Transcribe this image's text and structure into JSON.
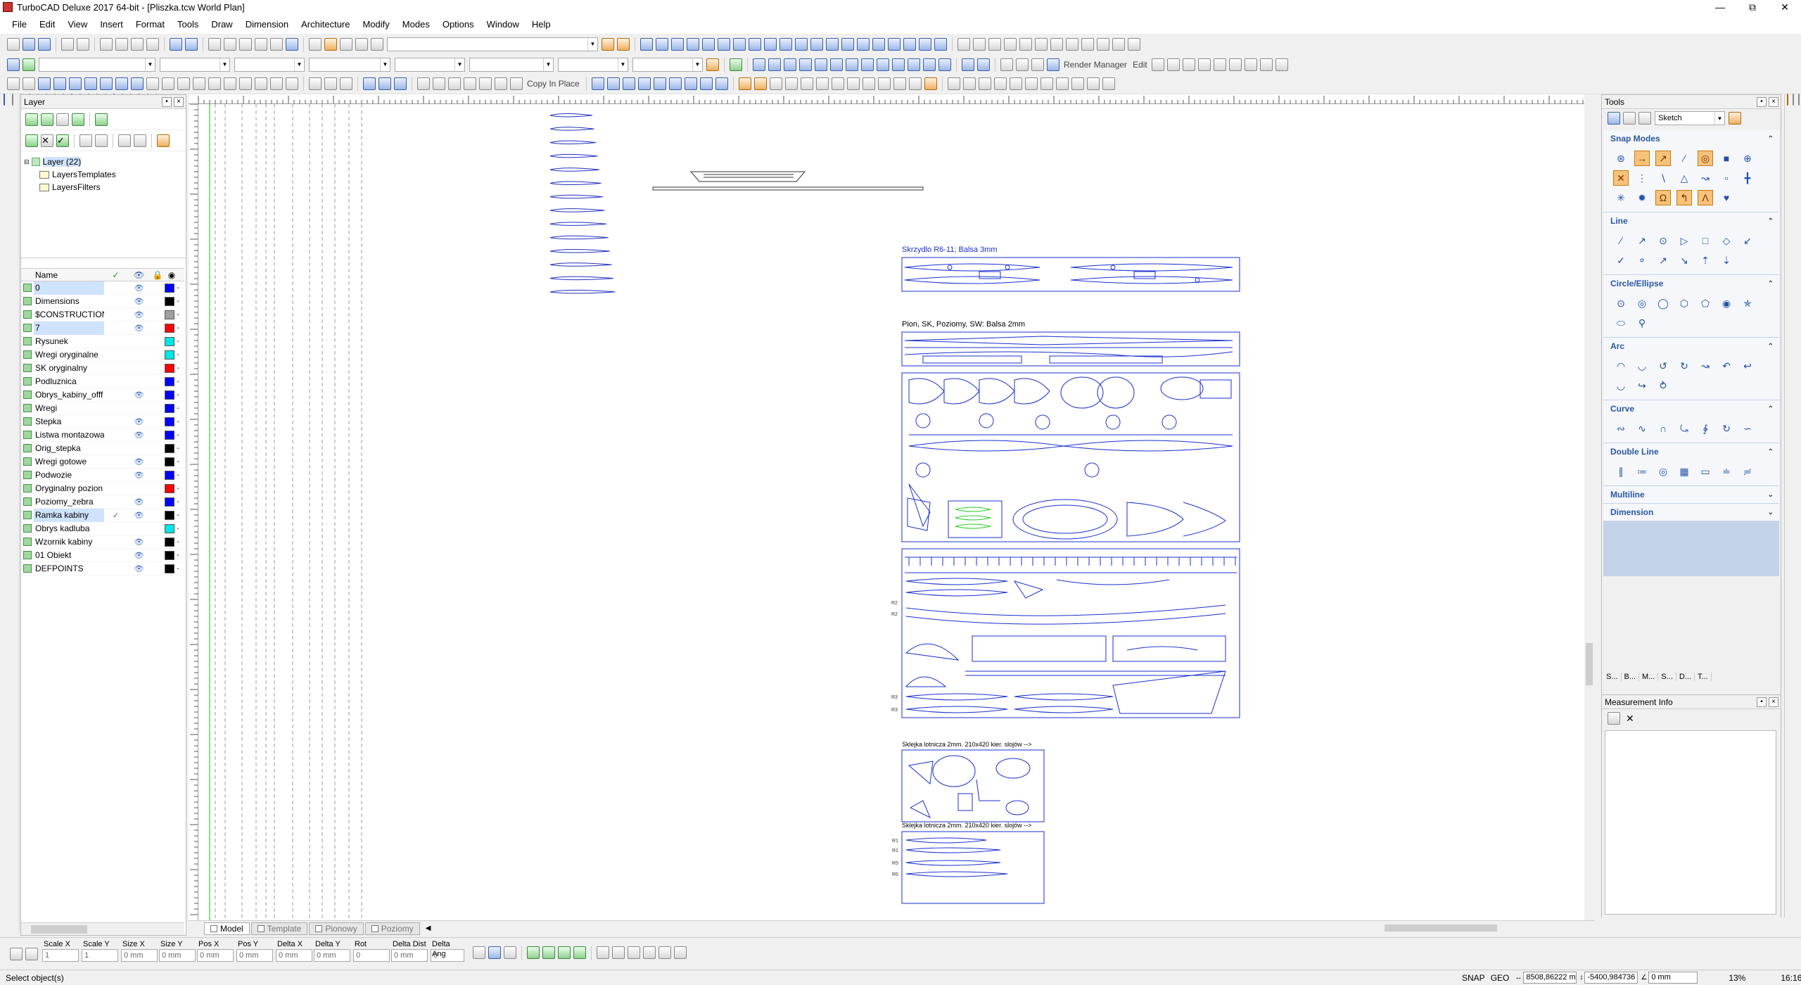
{
  "window": {
    "title": "TurboCAD Deluxe 2017 64-bit - [Pliszka.tcw World Plan]"
  },
  "menu": [
    "File",
    "Edit",
    "View",
    "Insert",
    "Format",
    "Tools",
    "Draw",
    "Dimension",
    "Architecture",
    "Modify",
    "Modes",
    "Options",
    "Window",
    "Help"
  ],
  "toolbar2": {
    "render_manager": "Render Manager",
    "edit": "Edit"
  },
  "toolbar3": {
    "copy_in_place": "Copy In Place"
  },
  "layer_panel": {
    "title": "Layer",
    "tree": [
      {
        "label": "Layer (22)"
      },
      {
        "label": "LayersTemplates"
      },
      {
        "label": "LayersFilters"
      }
    ],
    "columns": {
      "name": "Name"
    },
    "rows": [
      {
        "name": "0",
        "visible": true,
        "active": false,
        "color": "#0000ff",
        "selected": true
      },
      {
        "name": "Dimensions",
        "visible": true,
        "active": false,
        "color": "#000000",
        "selected": false
      },
      {
        "name": "$CONSTRUCTION",
        "visible": true,
        "active": false,
        "color": "#a0a0a0",
        "selected": false
      },
      {
        "name": "7",
        "visible": true,
        "active": false,
        "color": "#ff0000",
        "selected": true
      },
      {
        "name": "Rysunek",
        "visible": false,
        "active": false,
        "color": "#00e5e5",
        "selected": false
      },
      {
        "name": "Wregi oryginalne",
        "visible": false,
        "active": false,
        "color": "#00e5e5",
        "selected": false
      },
      {
        "name": "SK oryginalny",
        "visible": false,
        "active": false,
        "color": "#ff0000",
        "selected": false
      },
      {
        "name": "Podluznica",
        "visible": false,
        "active": false,
        "color": "#0000ff",
        "selected": false
      },
      {
        "name": "Obrys_kabiny_offf",
        "visible": true,
        "active": false,
        "color": "#0000ff",
        "selected": false
      },
      {
        "name": "Wregi",
        "visible": false,
        "active": false,
        "color": "#0000ff",
        "selected": false
      },
      {
        "name": "Stepka",
        "visible": true,
        "active": false,
        "color": "#0000ff",
        "selected": false
      },
      {
        "name": "Listwa montazowa",
        "visible": true,
        "active": false,
        "color": "#0000ff",
        "selected": false
      },
      {
        "name": "Orig_stepka",
        "visible": false,
        "active": false,
        "color": "#000000",
        "selected": false
      },
      {
        "name": "Wregi gotowe",
        "visible": true,
        "active": false,
        "color": "#000000",
        "selected": false
      },
      {
        "name": "Podwozie",
        "visible": true,
        "active": false,
        "color": "#0000ff",
        "selected": false
      },
      {
        "name": "Oryginalny pozion",
        "visible": false,
        "active": false,
        "color": "#ff0000",
        "selected": false
      },
      {
        "name": "Poziomy_zebra",
        "visible": true,
        "active": false,
        "color": "#0000ff",
        "selected": false
      },
      {
        "name": "Ramka kabiny",
        "visible": true,
        "active": true,
        "color": "#000000",
        "selected": true
      },
      {
        "name": "Obrys kadluba",
        "visible": false,
        "active": false,
        "color": "#00e5e5",
        "selected": false
      },
      {
        "name": "Wzornik kabiny",
        "visible": true,
        "active": false,
        "color": "#000000",
        "selected": false
      },
      {
        "name": "01 Obiekt",
        "visible": true,
        "active": false,
        "color": "#000000",
        "selected": false
      },
      {
        "name": "DEFPOINTS",
        "visible": true,
        "active": false,
        "color": "#000000",
        "selected": false
      }
    ]
  },
  "drawing": {
    "labels": {
      "wing": "Skrzydlo R6-11; Balsa 3mm",
      "tail": "Pion, SK, Poziomy, SW: Balsa 2mm",
      "ply1": "Sklejka lotnicza 2mm. 210x420 kier. slojów -->",
      "ply2": "Sklejka lotnicza 2mm. 210x420 kier. slojów -->"
    },
    "row_marks": {
      "r2a": "R2",
      "r2b": "R2",
      "r3a": "R3",
      "r3b": "R3",
      "r1a": "R1",
      "r1b": "R1",
      "r5": "R5",
      "r5b": "R5"
    }
  },
  "tabs": [
    {
      "label": "Model",
      "active": true
    },
    {
      "label": "Template",
      "active": false
    },
    {
      "label": "Pionowy",
      "active": false
    },
    {
      "label": "Poziomy",
      "active": false
    }
  ],
  "tools_panel": {
    "title": "Tools",
    "combo_value": "Sketch",
    "sections": [
      {
        "title": "Snap Modes",
        "expanded": true
      },
      {
        "title": "Line",
        "expanded": true
      },
      {
        "title": "Circle/Ellipse",
        "expanded": true
      },
      {
        "title": "Arc",
        "expanded": true
      },
      {
        "title": "Curve",
        "expanded": true
      },
      {
        "title": "Double Line",
        "expanded": true
      },
      {
        "title": "Multiline",
        "expanded": false
      },
      {
        "title": "Dimension",
        "expanded": false
      }
    ],
    "dock_tabs": [
      "S...",
      "B...",
      "M...",
      "S...",
      "D...",
      "T..."
    ]
  },
  "measurement": {
    "title": "Measurement Info"
  },
  "inspector": {
    "fields": [
      {
        "label": "Scale X",
        "value": "1"
      },
      {
        "label": "Scale Y",
        "value": "1"
      },
      {
        "label": "Size X",
        "value": "0 mm"
      },
      {
        "label": "Size Y",
        "value": "0 mm"
      },
      {
        "label": "Pos X",
        "value": "0 mm"
      },
      {
        "label": "Pos Y",
        "value": "0 mm"
      },
      {
        "label": "Delta X",
        "value": "0 mm"
      },
      {
        "label": "Delta Y",
        "value": "0 mm"
      },
      {
        "label": "Rot",
        "value": "0"
      },
      {
        "label": "Delta Dist",
        "value": "0 mm"
      },
      {
        "label": "Delta Ang",
        "value": "0"
      }
    ]
  },
  "status": {
    "message": "Select object(s)",
    "snap": "SNAP",
    "geo": "GEO",
    "coord_x": "8508,86222 m",
    "coord_y": "-5400,984736",
    "length": "0 mm",
    "zoom": "13%",
    "time": "16:16"
  }
}
